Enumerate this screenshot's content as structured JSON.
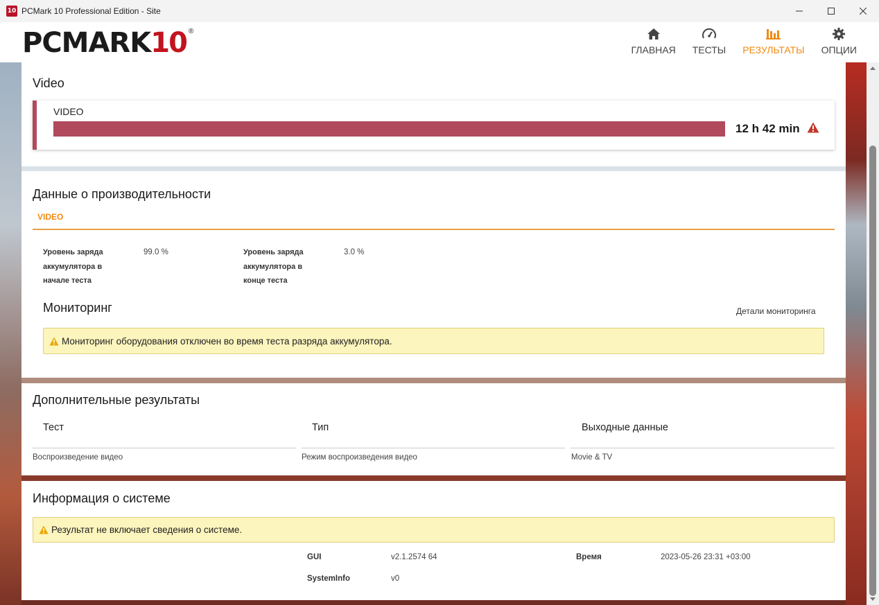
{
  "window": {
    "title": "PCMark 10 Professional Edition - Site",
    "app_icon_text": "10"
  },
  "header": {
    "logo_text": "PCMARK",
    "logo_number": "10",
    "logo_mark": "®",
    "nav": [
      {
        "label": "ГЛАВНАЯ",
        "icon": "home-icon",
        "active": false
      },
      {
        "label": "ТЕСТЫ",
        "icon": "gauge-icon",
        "active": false
      },
      {
        "label": "РЕЗУЛЬТАТЫ",
        "icon": "bar-chart-icon",
        "active": true
      },
      {
        "label": "ОПЦИИ",
        "icon": "gear-icon",
        "active": false
      }
    ]
  },
  "video_section": {
    "title": "Video",
    "test_name": "VIDEO",
    "score": "12 h 42 min",
    "bar_fill": 1.0,
    "bar_color": "#b14a5c"
  },
  "performance": {
    "title": "Данные о производительности",
    "tab": "VIDEO",
    "metrics": [
      {
        "label": "Уровень заряда аккумулятора в начале теста",
        "value": "99.0 %"
      },
      {
        "label": "Уровень заряда аккумулятора в конце теста",
        "value": "3.0 %"
      }
    ],
    "monitoring_title": "Мониторинг",
    "monitoring_link": "Детали мониторинга",
    "monitoring_notice": "Мониторинг оборудования отключен во время теста разряда аккумулятора."
  },
  "additional": {
    "title": "Дополнительные результаты",
    "headers": [
      "Тест",
      "Тип",
      "Выходные данные"
    ],
    "row": [
      "Воспроизведение видео",
      "Режим воспроизведения видео",
      "Movie & TV"
    ]
  },
  "system_info": {
    "title": "Информация о системе",
    "notice": "Результат не включает сведения о системе.",
    "gui_label": "GUI",
    "gui_value": "v2.1.2574 64",
    "time_label": "Время",
    "time_value": "2023-05-26 23:31 +03:00",
    "sysinfo_label": "SystemInfo",
    "sysinfo_value": "v0"
  },
  "colors": {
    "accent": "#ef8b14",
    "video_bar": "#b14a5c",
    "warning_red": "#c0392b",
    "warning_yellow": "#e9a800",
    "notice_bg": "#fcf5bd"
  }
}
